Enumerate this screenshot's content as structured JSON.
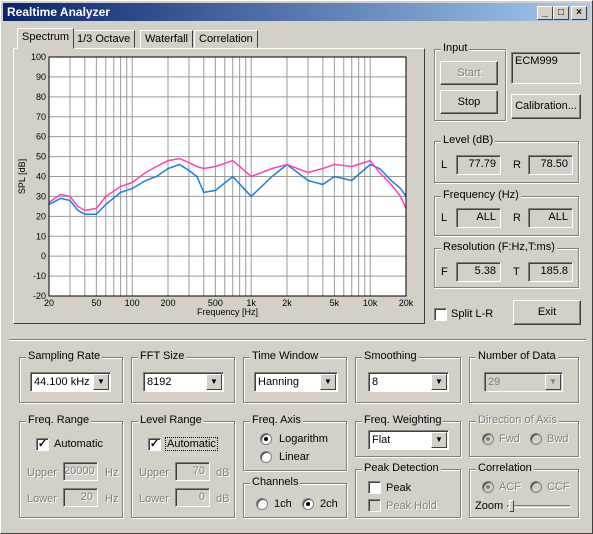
{
  "window": {
    "title": "Realtime Analyzer",
    "min": "_",
    "max": "□",
    "close": "×"
  },
  "tabs": [
    "Spectrum",
    "1/3 Octave",
    "Waterfall",
    "Correlation"
  ],
  "chart_data": {
    "type": "line",
    "ylabel": "SPL [dB]",
    "xlabel": "Frequency  [Hz]",
    "x_scale": "log",
    "xlim": [
      20,
      20000
    ],
    "ylim": [
      -20,
      100
    ],
    "yticks": [
      100,
      90,
      80,
      70,
      60,
      50,
      40,
      30,
      20,
      10,
      0,
      -10,
      -20
    ],
    "xticks": [
      "20",
      "50",
      "100",
      "200",
      "500",
      "1k",
      "2k",
      "5k",
      "10k",
      "20k"
    ],
    "xtick_values": [
      20,
      50,
      100,
      200,
      500,
      1000,
      2000,
      5000,
      10000,
      20000
    ],
    "grid": true,
    "series": [
      {
        "color": "#1e7fd8",
        "x": [
          20,
          25,
          30,
          35,
          40,
          50,
          60,
          80,
          100,
          130,
          160,
          200,
          250,
          300,
          350,
          400,
          500,
          700,
          1000,
          1500,
          2000,
          3000,
          4000,
          5000,
          7000,
          10000,
          12000,
          15000,
          18000,
          20000
        ],
        "y": [
          26,
          29,
          28,
          23,
          21,
          21,
          26,
          32,
          34,
          38,
          40,
          44,
          46,
          43,
          40,
          32,
          33,
          40,
          30,
          40,
          46,
          38,
          36,
          40,
          38,
          46,
          44,
          38,
          34,
          30
        ]
      },
      {
        "color": "#ff3fbf",
        "x": [
          20,
          25,
          30,
          35,
          40,
          50,
          60,
          80,
          100,
          130,
          160,
          200,
          250,
          300,
          350,
          400,
          500,
          700,
          1000,
          1500,
          2000,
          3000,
          4000,
          5000,
          7000,
          10000,
          12000,
          15000,
          18000,
          20000
        ],
        "y": [
          27,
          31,
          30,
          25,
          23,
          24,
          30,
          35,
          37,
          42,
          45,
          48,
          49,
          47,
          45,
          44,
          45,
          48,
          40,
          44,
          46,
          42,
          44,
          46,
          45,
          48,
          42,
          36,
          30,
          24
        ]
      }
    ]
  },
  "input": {
    "label": "Input",
    "start": "Start",
    "stop": "Stop",
    "device": "ECM999",
    "calibration": "Calibration..."
  },
  "level": {
    "label": "Level (dB)",
    "l_label": "L",
    "l_value": "77.79",
    "r_label": "R",
    "r_value": "78.50"
  },
  "frequency": {
    "label": "Frequency (Hz)",
    "l_label": "L",
    "l_value": "ALL",
    "r_label": "R",
    "r_value": "ALL"
  },
  "resolution": {
    "label": "Resolution (F:Hz,T:ms)",
    "f_label": "F",
    "f_value": "5.38",
    "t_label": "T",
    "t_value": "185.8"
  },
  "split": {
    "label": "Split L-R",
    "checked": false
  },
  "exit_label": "Exit",
  "sampling_rate": {
    "label": "Sampling Rate",
    "value": "44.100 kHz"
  },
  "fft_size": {
    "label": "FFT Size",
    "value": "8192"
  },
  "time_window": {
    "label": "Time Window",
    "value": "Hanning"
  },
  "smoothing": {
    "label": "Smoothing",
    "value": "8"
  },
  "number_of_data": {
    "label": "Number of Data",
    "value": "29"
  },
  "freq_range": {
    "label": "Freq. Range",
    "auto_label": "Automatic",
    "upper_label": "Upper",
    "upper_value": "20000",
    "lower_label": "Lower",
    "lower_value": "20",
    "unit": "Hz"
  },
  "level_range": {
    "label": "Level Range",
    "auto_label": "Automatic",
    "upper_label": "Upper",
    "upper_value": "70",
    "lower_label": "Lower",
    "lower_value": "0",
    "unit": "dB"
  },
  "freq_axis": {
    "label": "Freq. Axis",
    "log_label": "Logarithm",
    "lin_label": "Linear"
  },
  "channels": {
    "label": "Channels",
    "ch1": "1ch",
    "ch2": "2ch"
  },
  "freq_weighting": {
    "label": "Freq. Weighting",
    "value": "Flat"
  },
  "peak_detection": {
    "label": "Peak Detection",
    "peak": "Peak",
    "peak_hold": "Peak Hold"
  },
  "direction": {
    "label": "Direction of Axis",
    "fwd": "Fwd",
    "bwd": "Bwd"
  },
  "correlation": {
    "label": "Correlation",
    "acf": "ACF",
    "ccf": "CCF",
    "zoom": "Zoom"
  },
  "glyphs": {
    "check": "✓",
    "arrow": "▼"
  }
}
